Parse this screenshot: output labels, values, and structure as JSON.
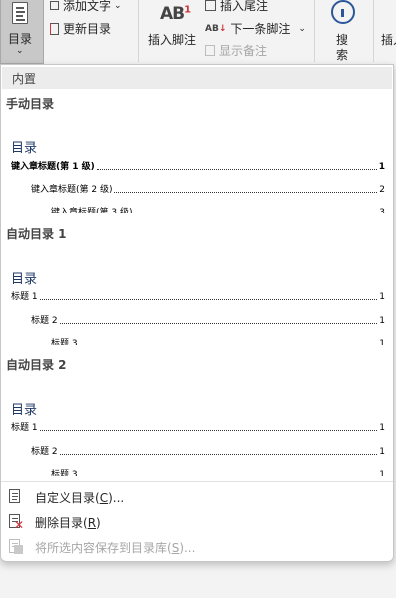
{
  "ribbon": {
    "toc_button": {
      "label": "目录",
      "chevron": "⌄"
    },
    "add_text": "添加文字",
    "update_toc": "更新目录",
    "insert_footnote": "插入脚注",
    "footnote_icon_text": "AB",
    "footnote_icon_sup": "1",
    "insert_endnote": "插入尾注",
    "next_footnote": "下一条脚注",
    "show_notes": "显示备注",
    "search_line1": "搜",
    "search_line2": "索",
    "insert_cut": "插入"
  },
  "dropdown": {
    "header": "内置",
    "galleries": [
      {
        "title": "手动目录",
        "preview_title": "目录",
        "entries": [
          {
            "text": "键入章标题(第 1 级)",
            "page": "1"
          },
          {
            "text": "键入章标题(第 2 级)",
            "page": "2"
          },
          {
            "text": "键入章标题(第 3 级)",
            "page": "3"
          }
        ]
      },
      {
        "title": "自动目录 1",
        "preview_title": "目录",
        "entries": [
          {
            "text": "标题 1",
            "page": "1"
          },
          {
            "text": "标题 2",
            "page": "1"
          },
          {
            "text": "标题 3",
            "page": "1"
          }
        ]
      },
      {
        "title": "自动目录 2",
        "preview_title": "目录",
        "entries": [
          {
            "text": "标题 1",
            "page": "1"
          },
          {
            "text": "标题 2",
            "page": "1"
          },
          {
            "text": "标题 3",
            "page": "1"
          }
        ]
      }
    ],
    "menu": [
      {
        "label": "自定义目录(",
        "key": "C",
        "suffix": ")...",
        "enabled": true,
        "icon": "document-icon"
      },
      {
        "label": "删除目录(",
        "key": "R",
        "suffix": ")",
        "enabled": true,
        "icon": "delete-toc-icon"
      },
      {
        "label": "将所选内容保存到目录库(",
        "key": "S",
        "suffix": ")...",
        "enabled": false,
        "icon": "save-to-gallery-icon"
      }
    ]
  }
}
